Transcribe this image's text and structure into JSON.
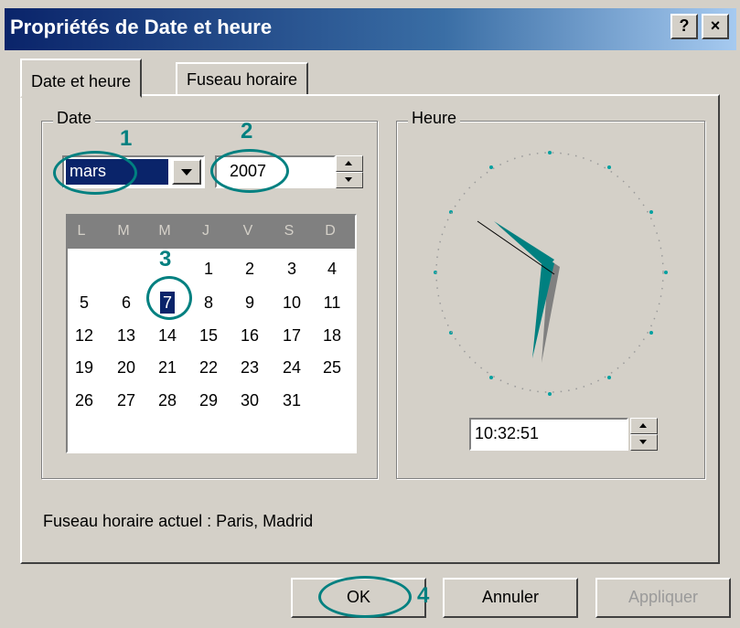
{
  "window": {
    "title": "Propriétés de Date et heure",
    "help_label": "?",
    "close_label": "×"
  },
  "tabs": [
    {
      "label": "Date et heure"
    },
    {
      "label": "Fuseau horaire"
    }
  ],
  "date_group": {
    "label": "Date",
    "month_value": "mars",
    "year_value": "2007",
    "weekday_headers": [
      "L",
      "M",
      "M",
      "J",
      "V",
      "S",
      "D"
    ],
    "days": [
      "1",
      "2",
      "3",
      "4",
      "5",
      "6",
      "7",
      "8",
      "9",
      "10",
      "11",
      "12",
      "13",
      "14",
      "15",
      "16",
      "17",
      "18",
      "19",
      "20",
      "21",
      "22",
      "23",
      "24",
      "25",
      "26",
      "27",
      "28",
      "29",
      "30",
      "31"
    ],
    "selected_day": "7"
  },
  "time_group": {
    "label": "Heure",
    "time_value": "10:32:51"
  },
  "timezone_text": "Fuseau horaire actuel : Paris, Madrid",
  "buttons": {
    "ok": "OK",
    "cancel": "Annuler",
    "apply": "Appliquer"
  },
  "annotations": {
    "n1": "1",
    "n2": "2",
    "n3": "3",
    "n4": "4"
  },
  "colors": {
    "title_bar": "#0a246a",
    "annotation": "#008080",
    "selection": "#0a246a"
  }
}
